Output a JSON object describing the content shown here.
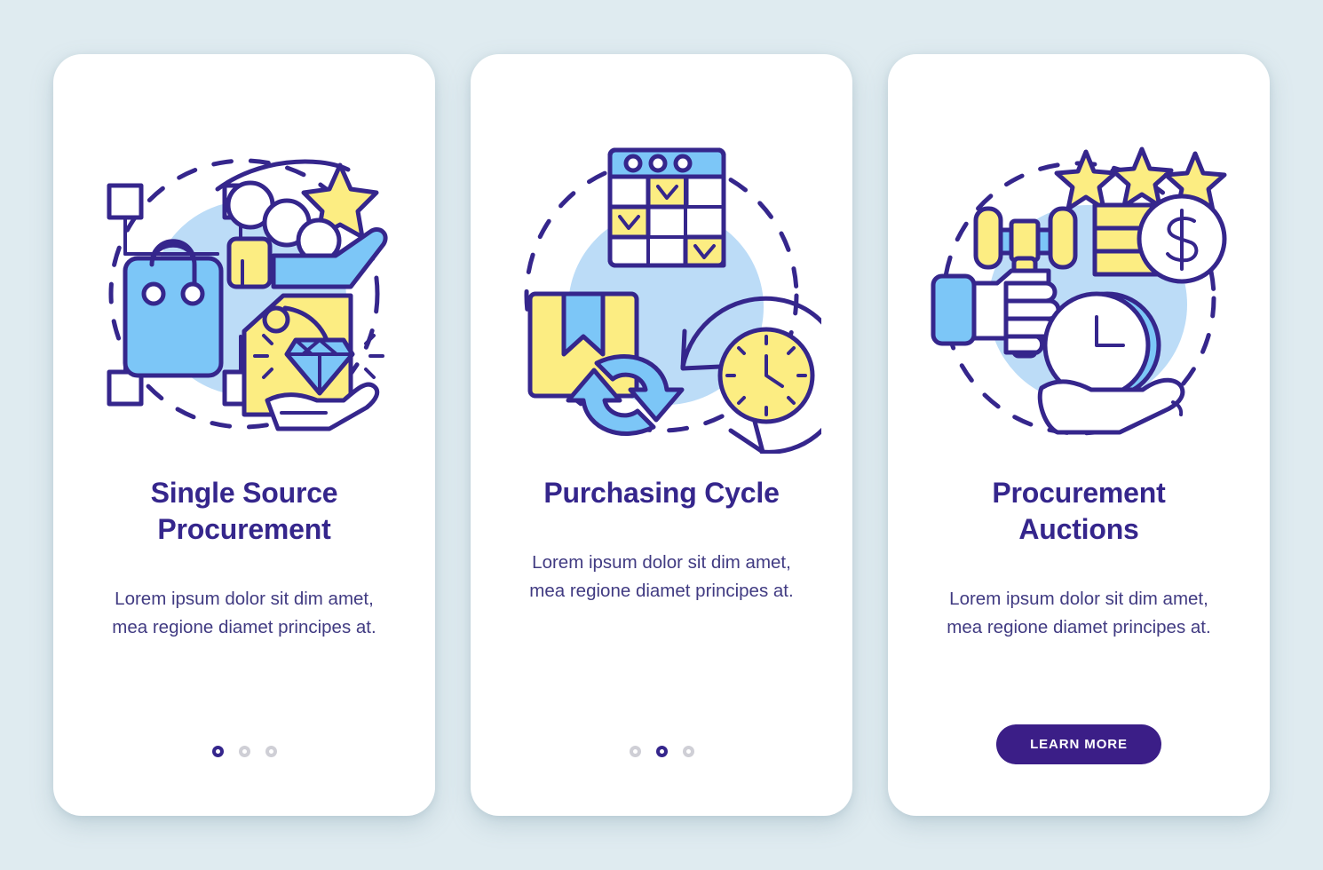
{
  "theme": {
    "page_background": "#dfebf0",
    "card_background": "#ffffff",
    "title_color": "#35268c",
    "body_color": "#413b82",
    "accent_purple": "#3b1e87",
    "illustration_yellow": "#fced82",
    "illustration_blue": "#7cc6f7",
    "illustration_blob": "#bcdcf7",
    "dot_inactive": "#cfcfd6"
  },
  "screens": [
    {
      "id": "single-source-procurement",
      "illustration_name": "single-source-procurement-illustration",
      "illustration_elements": [
        "shopping-bag-icon",
        "network-node-squares",
        "people-group-icon",
        "star-icon",
        "price-tag-icon",
        "diamond-icon",
        "open-hand-icon",
        "dashed-circle"
      ],
      "title": "Single Source Procurement",
      "body": "Lorem ipsum dolor sit dim amet, mea regione diamet principes at.",
      "footer_type": "dots",
      "dots": {
        "count": 3,
        "active_index": 0
      }
    },
    {
      "id": "purchasing-cycle",
      "illustration_name": "purchasing-cycle-illustration",
      "illustration_elements": [
        "calendar-grid-icon",
        "checkmark-cells",
        "package-box-icon",
        "refresh-arrows-icon",
        "clock-icon",
        "circular-arrow-icon",
        "dashed-circle"
      ],
      "title": "Purchasing Cycle",
      "body": "Lorem ipsum dolor sit dim amet, mea regione diamet principes at.",
      "footer_type": "dots",
      "dots": {
        "count": 3,
        "active_index": 1
      }
    },
    {
      "id": "procurement-auctions",
      "illustration_name": "procurement-auctions-illustration",
      "illustration_elements": [
        "star-icon",
        "star-icon",
        "star-icon",
        "gavel-icon",
        "hand-holding-gavel-icon",
        "coin-stack-icon",
        "dollar-coin-icon",
        "clock-icon",
        "open-hand-icon",
        "dashed-circle"
      ],
      "title": "Procurement Auctions",
      "body": "Lorem ipsum dolor sit dim amet, mea regione diamet principes at.",
      "footer_type": "button",
      "button_label": "LEARN MORE"
    }
  ]
}
